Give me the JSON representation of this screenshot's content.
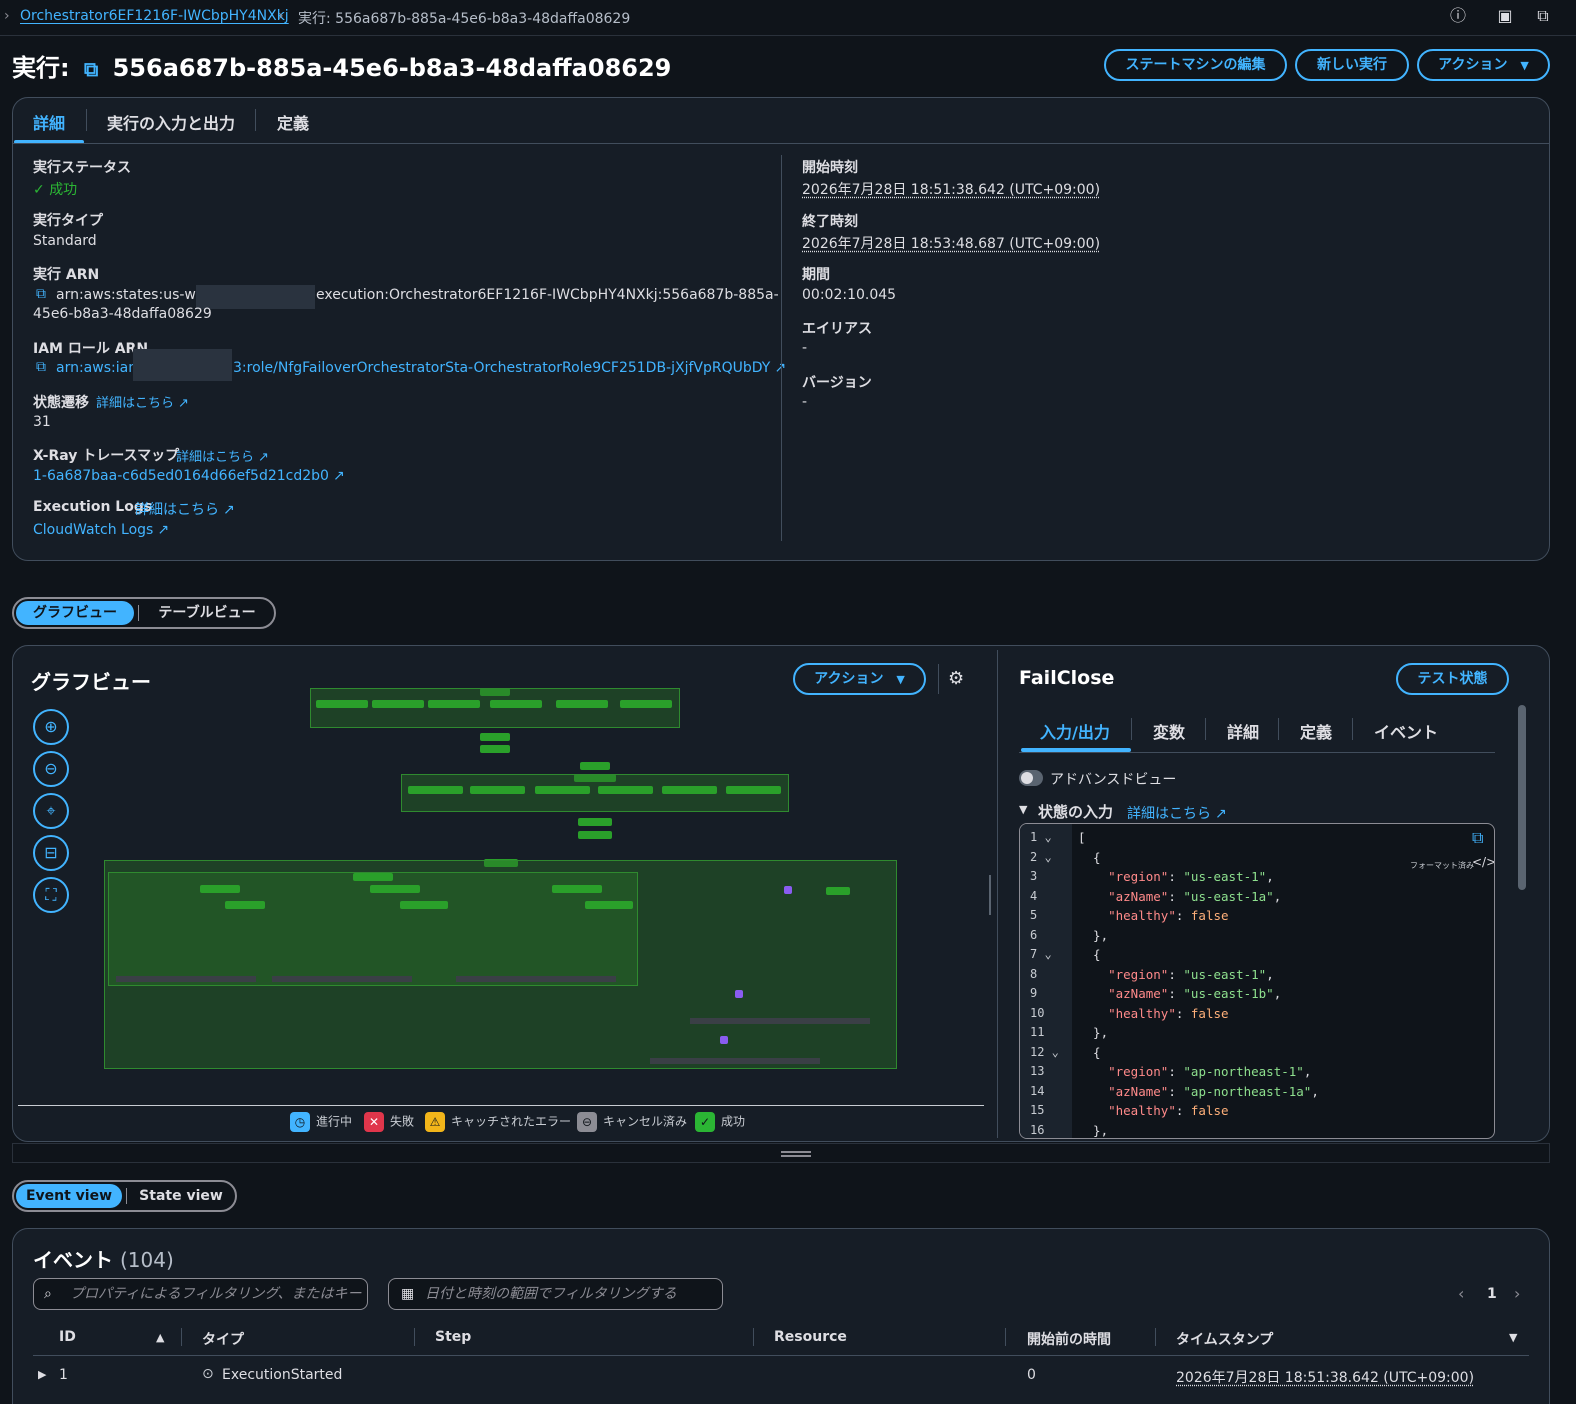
{
  "breadcrumb": {
    "parent": "Orchestrator6EF1216F-IWCbpHY4NXkj",
    "current": "実行: 556a687b-885a-45e6-b8a3-48daffa08629"
  },
  "header": {
    "title_prefix": "実行:",
    "execution_id": "556a687b-885a-45e6-b8a3-48daffa08629",
    "edit_button": "ステートマシンの編集",
    "new_exec_button": "新しい実行",
    "actions_button": "アクション"
  },
  "details_tabs": [
    "詳細",
    "実行の入力と出力",
    "定義"
  ],
  "details": {
    "status_label": "実行ステータス",
    "status_value": "成功",
    "type_label": "実行タイプ",
    "type_value": "Standard",
    "arn_label": "実行 ARN",
    "arn_part1": "arn:aws:states:us-west",
    "arn_part2": "execution:Orchestrator6EF1216F-IWCbpHY4NXkj:556a687b-885a-",
    "arn_part3": "45e6-b8a3-48daffa08629",
    "iam_label": "IAM ロール ARN",
    "iam_part1": "arn:aws:iam:",
    "iam_part2": "3:role/NfgFailoverOrchestratorSta-OrchestratorRole9CF251DB-jXjfVpRQUbDY",
    "transitions_label": "状態遷移",
    "learn_more": "詳細はこちら",
    "transitions_value": "31",
    "xray_label": "X-Ray トレースマップ",
    "xray_value": "1-6a687baa-c6d5ed0164d66ef5d21cd2b0",
    "logs_label": "Execution Logs",
    "logs_value": "CloudWatch Logs",
    "start_label": "開始時刻",
    "start_value": "2026年7月28日 18:51:38.642 (UTC+09:00)",
    "end_label": "終了時刻",
    "end_value": "2026年7月28日 18:53:48.687 (UTC+09:00)",
    "duration_label": "期間",
    "duration_value": "00:02:10.045",
    "alias_label": "エイリアス",
    "alias_value": "-",
    "version_label": "バージョン",
    "version_value": "-"
  },
  "view_toggle": {
    "graph": "グラフビュー",
    "table": "テーブルビュー"
  },
  "graph": {
    "title": "グラフビュー",
    "actions": "アクション",
    "legend": [
      "進行中",
      "失敗",
      "キャッチされたエラー",
      "キャンセル済み",
      "成功"
    ]
  },
  "state_panel": {
    "title": "FailClose",
    "test_button": "テスト状態",
    "tabs": [
      "入力/出力",
      "変数",
      "詳細",
      "定義",
      "イベント"
    ],
    "advanced_view": "アドバンスドビュー",
    "input_title": "状態の入力",
    "learn_more": "詳細はこちら",
    "formatted": "フォーマット済み",
    "code_lines": [
      "[",
      "  {",
      "    \"region\": \"us-east-1\",",
      "    \"azName\": \"us-east-1a\",",
      "    \"healthy\": false",
      "  },",
      "  {",
      "    \"region\": \"us-east-1\",",
      "    \"azName\": \"us-east-1b\",",
      "    \"healthy\": false",
      "  },",
      "  {",
      "    \"region\": \"ap-northeast-1\",",
      "    \"azName\": \"ap-northeast-1a\",",
      "    \"healthy\": false",
      "  },"
    ]
  },
  "event_toggle": {
    "event": "Event view",
    "state": "State view"
  },
  "events": {
    "title": "イベント",
    "count": "(104)",
    "filter_placeholder": "プロパティによるフィルタリング、またはキー",
    "date_placeholder": "日付と時刻の範囲でフィルタリングする",
    "page": "1",
    "columns": [
      "ID",
      "タイプ",
      "Step",
      "Resource",
      "開始前の時間",
      "タイムスタンプ"
    ],
    "rows": [
      {
        "id": "1",
        "type": "ExecutionStarted",
        "step": "",
        "resource": "",
        "elapsed": "0",
        "timestamp": "2026年7月28日 18:51:38.642 (UTC+09:00)"
      }
    ]
  }
}
